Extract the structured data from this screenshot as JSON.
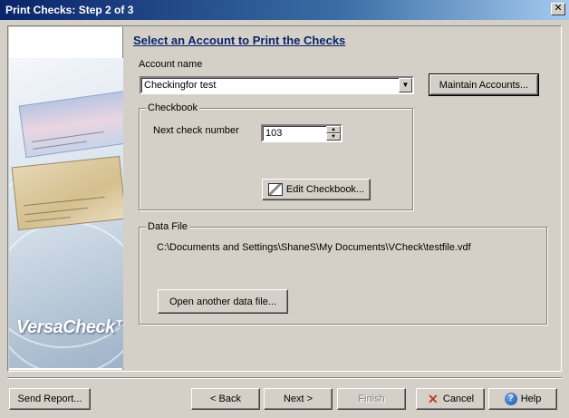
{
  "window": {
    "title": "Print Checks: Step 2 of 3",
    "close_glyph": "✕"
  },
  "sidebar": {
    "logo": "VersaCheck™"
  },
  "main": {
    "heading": "Select an Account to Print the Checks",
    "account_label": "Account name",
    "account_value": "Checkingfor test",
    "maintain_button": "Maintain Accounts...",
    "checkbook": {
      "title": "Checkbook",
      "next_check_label": "Next check number",
      "next_check_value": "103",
      "edit_button": "Edit Checkbook..."
    },
    "datafile": {
      "title": "Data File",
      "path": "C:\\Documents and Settings\\ShaneS\\My Documents\\VCheck\\testfile.vdf",
      "open_button": "Open another data file..."
    }
  },
  "footer": {
    "send_report": "Send Report...",
    "back": "< Back",
    "next": "Next >",
    "finish": "Finish",
    "cancel": "Cancel",
    "help": "Help"
  },
  "icons": {
    "close": "close-icon",
    "dropdown": "chevron-down-icon",
    "edit": "edit-icon",
    "cancel": "cancel-icon",
    "help": "help-icon"
  }
}
